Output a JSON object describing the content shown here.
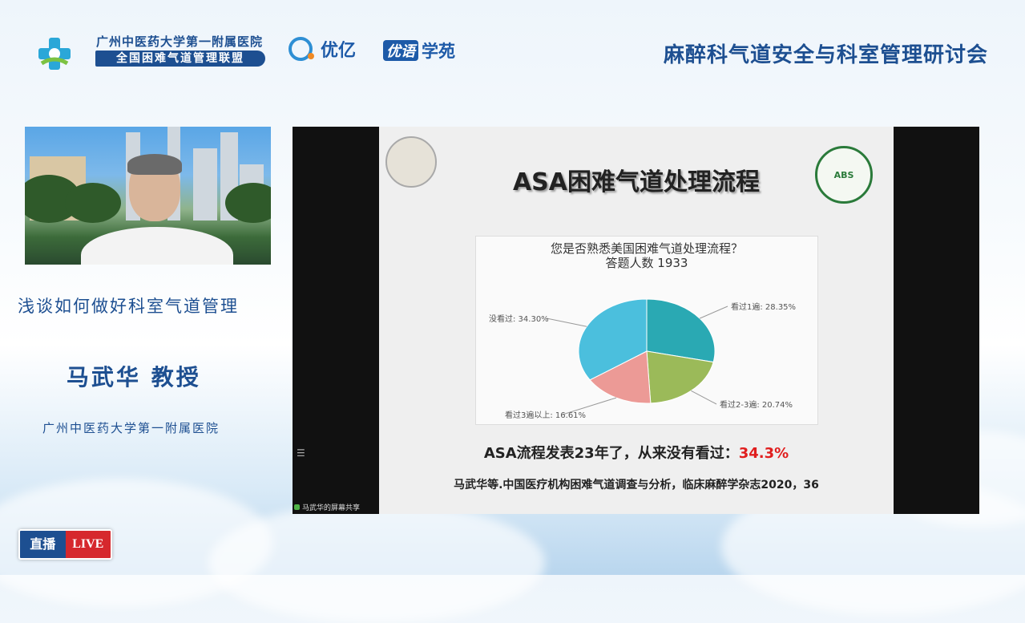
{
  "header": {
    "org_line1": "广州中医药大学第一附属医院",
    "org_line2": "全国困难气道管理联盟",
    "brand1": "优亿",
    "brand2_box": "优语",
    "brand2_text": "学苑",
    "conference_title": "麻醉科气道安全与科室管理研讨会"
  },
  "speaker": {
    "talk_title": "浅谈如何做好科室气道管理",
    "name": "马武华 教授",
    "organization": "广州中医药大学第一附属医院"
  },
  "live_badge": {
    "cn": "直播",
    "en": "LIVE"
  },
  "slide": {
    "title": "ASA困难气道处理流程",
    "statement_prefix": "ASA流程发表23年了，从来没有看过：",
    "statement_value": "34.3%",
    "reference": "马武华等.中国医疗机构困难气道调查与分析，临床麻醉学杂志2020，36",
    "seal_right_text": "ABS",
    "share_label": "马武华的屏幕共享"
  },
  "chart_data": {
    "type": "pie",
    "title": "您是否熟悉美国困难气道处理流程？",
    "subtitle": "答题人数 1933",
    "slices": [
      {
        "label": "看过1遍: 28.35%",
        "value": 28.35,
        "color": "#2aa9b3"
      },
      {
        "label": "看过2-3遍: 20.74%",
        "value": 20.74,
        "color": "#9bba59"
      },
      {
        "label": "看过3遍以上: 16.61%",
        "value": 16.61,
        "color": "#ec9a96"
      },
      {
        "label": "没看过: 34.30%",
        "value": 34.3,
        "color": "#4bbfdd"
      }
    ]
  }
}
